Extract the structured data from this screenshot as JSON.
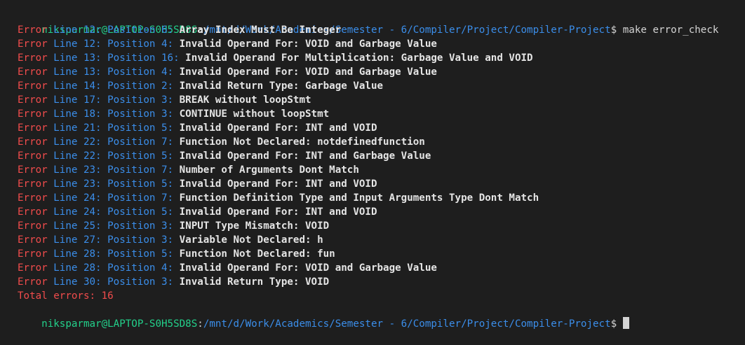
{
  "prompt": {
    "user_host": "niksparmar@LAPTOP-S0H5SD8S",
    "separator": ":",
    "path": "/mnt/d/Work/Academics/Semester - 6/Compiler/Project/Compiler-Project",
    "symbol": "$",
    "command": " make error_check"
  },
  "errors": [
    {
      "label": "Error",
      "location": " Line 12: Position 6:",
      "message": " Array Index Must Be Integer"
    },
    {
      "label": "Error",
      "location": " Line 12: Position 4:",
      "message": " Invalid Operand For: VOID and Garbage Value"
    },
    {
      "label": "Error",
      "location": " Line 13: Position 16:",
      "message": " Invalid Operand For Multiplication: Garbage Value and VOID"
    },
    {
      "label": "Error",
      "location": " Line 13: Position 4:",
      "message": " Invalid Operand For: VOID and Garbage Value"
    },
    {
      "label": "Error",
      "location": " Line 14: Position 2:",
      "message": " Invalid Return Type: Garbage Value"
    },
    {
      "label": "Error",
      "location": " Line 17: Position 3:",
      "message": " BREAK without loopStmt"
    },
    {
      "label": "Error",
      "location": " Line 18: Position 3:",
      "message": " CONTINUE without loopStmt"
    },
    {
      "label": "Error",
      "location": " Line 21: Position 5:",
      "message": " Invalid Operand For: INT and VOID"
    },
    {
      "label": "Error",
      "location": " Line 22: Position 7:",
      "message": " Function Not Declared: notdefinedfunction"
    },
    {
      "label": "Error",
      "location": " Line 22: Position 5:",
      "message": " Invalid Operand For: INT and Garbage Value"
    },
    {
      "label": "Error",
      "location": " Line 23: Position 7:",
      "message": " Number of Arguments Dont Match"
    },
    {
      "label": "Error",
      "location": " Line 23: Position 5:",
      "message": " Invalid Operand For: INT and VOID"
    },
    {
      "label": "Error",
      "location": " Line 24: Position 7:",
      "message": " Function Definition Type and Input Arguments Type Dont Match"
    },
    {
      "label": "Error",
      "location": " Line 24: Position 5:",
      "message": " Invalid Operand For: INT and VOID"
    },
    {
      "label": "Error",
      "location": " Line 25: Position 3:",
      "message": " INPUT Type Mismatch: VOID"
    },
    {
      "label": "Error",
      "location": " Line 27: Position 3:",
      "message": " Variable Not Declared: h"
    },
    {
      "label": "Error",
      "location": " Line 28: Position 5:",
      "message": " Function Not Declared: fun"
    },
    {
      "label": "Error",
      "location": " Line 28: Position 4:",
      "message": " Invalid Operand For: VOID and Garbage Value"
    },
    {
      "label": "Error",
      "location": " Line 30: Position 3:",
      "message": " Invalid Return Type: VOID"
    }
  ],
  "total": "Total errors: 16",
  "final_prompt": {
    "user_host": "niksparmar@LAPTOP-S0H5SD8S",
    "separator": ":",
    "path": "/mnt/d/Work/Academics/Semester - 6/Compiler/Project/Compiler-Project",
    "symbol": "$",
    "trailing": " "
  },
  "colors": {
    "background": "#1e1e1e",
    "prompt_user": "#23d18b",
    "prompt_path": "#3b8eea",
    "error_word": "#f14c4c",
    "error_location": "#3b8eea",
    "error_message": "#e5e5e5"
  }
}
